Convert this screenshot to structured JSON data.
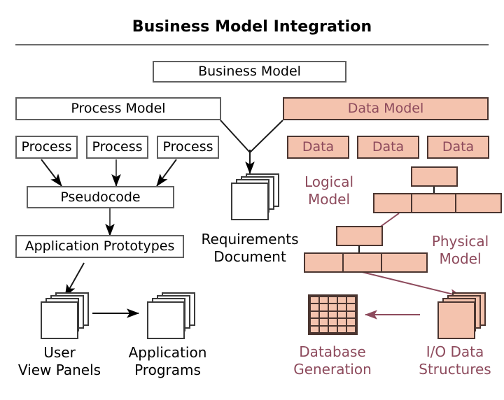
{
  "title": "Business Model Integration",
  "colors": {
    "salmon_fill": "#f4c3ae",
    "salmon_stroke": "#4a3530",
    "plum_text": "#8d4a5c",
    "white_fill": "#ffffff",
    "gray_stroke": "#5f5f5f",
    "black_text": "#000000",
    "plum_arrow": "#8d4a5c",
    "black_arrow": "#000000"
  },
  "nodes": {
    "business_model": "Business Model",
    "process_model": "Process Model",
    "data_model": "Data Model",
    "process_1": "Process",
    "process_2": "Process",
    "process_3": "Process",
    "data_1": "Data",
    "data_2": "Data",
    "data_3": "Data",
    "pseudocode": "Pseudocode",
    "application_prototypes": "Application Prototypes"
  },
  "labels": {
    "requirements_document": "Requirements\nDocument",
    "logical_model": "Logical\nModel",
    "physical_model": "Physical\nModel",
    "user_view_panels": "User\nView Panels",
    "application_programs": "Application\nPrograms",
    "database_generation": "Database\nGeneration",
    "io_data_structures": "I/O Data\nStructures"
  },
  "database_grid": {
    "rows": 5,
    "cols": 5
  },
  "stacks": {
    "sheet_count": 4
  }
}
